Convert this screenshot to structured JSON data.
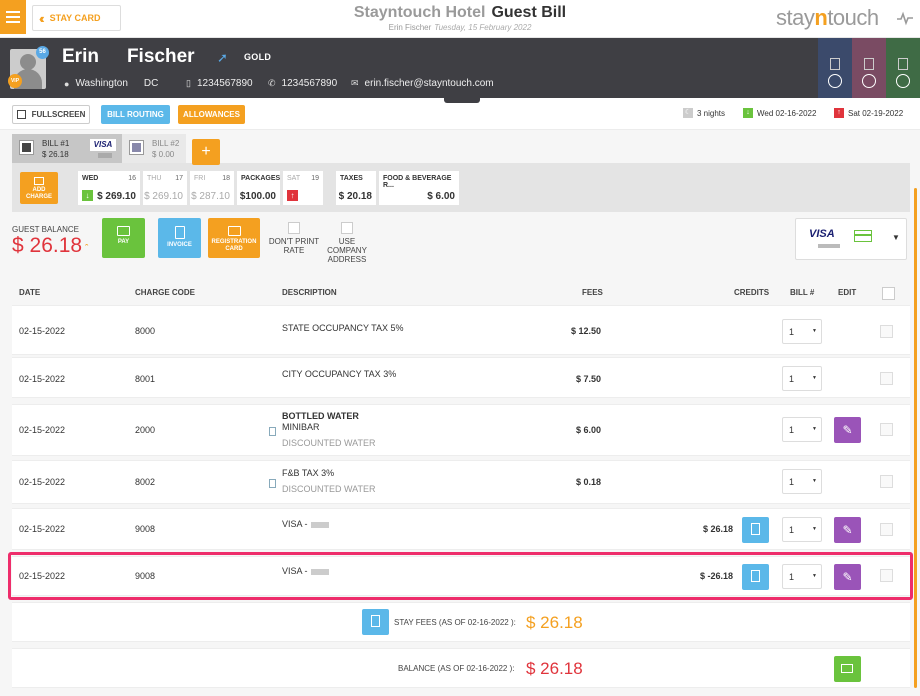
{
  "topbar": {
    "stay_card_label": "STAY CARD",
    "hotel_name": "Stayntouch Hotel",
    "page_title": "Guest Bill",
    "guest_name": "Erin Fischer",
    "date": "Tuesday, 15 February 2022",
    "logo_left": "stay",
    "logo_mid": "n",
    "logo_right": "touch"
  },
  "guest": {
    "first_name": "Erin",
    "last_name": "Fischer",
    "level": "GOLD",
    "vip": "VIP",
    "badge_count": "56",
    "city": "Washington",
    "state": "DC",
    "phone1": "1234567890",
    "phone2": "1234567890",
    "email": "erin.fischer@stayntouch.com"
  },
  "colors": {
    "accent": "#f4a020",
    "header_bg": "#3f3f44",
    "balance_red": "#e0343c",
    "purple": "#9a54b8",
    "blue": "#5bb8e9",
    "green": "#6ac33d",
    "highlight": "#ee2d6b",
    "side_tab_1": "#3b4a6b",
    "side_tab_2": "#7a4b63",
    "side_tab_3": "#3f6b45"
  },
  "actions": {
    "fullscreen": "FULLSCREEN",
    "bill_routing": "BILL ROUTING",
    "allowances": "ALLOWANCES"
  },
  "stay": {
    "nights": "3 nights",
    "arrival": "Wed 02-16-2022",
    "departure": "Sat 02-19-2022"
  },
  "bills": [
    {
      "label": "BILL #1",
      "amount": "$ 26.18",
      "card": "VISA"
    },
    {
      "label": "BILL #2",
      "amount": "$ 0.00"
    }
  ],
  "add_bill": "+",
  "add_charge": "ADD CHARGE",
  "days": [
    {
      "day": "WED",
      "num": "16",
      "value": "$ 269.10"
    },
    {
      "day": "THU",
      "num": "17",
      "value": "$ 269.10"
    },
    {
      "day": "FRI",
      "num": "18",
      "value": "$ 287.10"
    },
    {
      "day": "PACKAGES",
      "num": "",
      "value": "$100.00"
    },
    {
      "day": "SAT",
      "num": "19",
      "value": ""
    },
    {
      "day": "TAXES",
      "num": "",
      "value": "$ 20.18"
    },
    {
      "day": "FOOD & BEVERAGE R...",
      "num": "",
      "value": "$ 6.00"
    }
  ],
  "summary": {
    "guest_balance_label": "GUEST BALANCE",
    "guest_balance": "$ 26.18",
    "pay": "PAY",
    "invoice": "INVOICE",
    "registration_card": "REGISTRATION CARD",
    "dont_print_rate": "DON'T PRINT RATE",
    "use_company_address": "USE COMPANY ADDRESS",
    "card_brand": "VISA"
  },
  "table": {
    "headers": {
      "date": "DATE",
      "charge_code": "CHARGE CODE",
      "description": "DESCRIPTION",
      "fees": "FEES",
      "credits": "CREDITS",
      "bill": "BILL #",
      "edit": "EDIT"
    },
    "rows": [
      {
        "date": "02-15-2022",
        "code": "8000",
        "desc": "STATE OCCUPANCY TAX 5%",
        "sub1": "",
        "sub2": "",
        "fee": "$ 12.50",
        "credit": "",
        "bill": "1"
      },
      {
        "date": "02-15-2022",
        "code": "8001",
        "desc": "CITY OCCUPANCY TAX 3%",
        "sub1": "",
        "sub2": "",
        "fee": "$ 7.50",
        "credit": "",
        "bill": "1"
      },
      {
        "date": "02-15-2022",
        "code": "2000",
        "desc": "BOTTLED WATER",
        "sub1": "MINIBAR",
        "sub2": "DISCOUNTED WATER",
        "fee": "$ 6.00",
        "credit": "",
        "bill": "1"
      },
      {
        "date": "02-15-2022",
        "code": "8002",
        "desc": "F&B TAX 3%",
        "sub1": "",
        "sub2": "DISCOUNTED WATER",
        "fee": "$ 0.18",
        "credit": "",
        "bill": "1"
      },
      {
        "date": "02-15-2022",
        "code": "9008",
        "desc": "VISA -",
        "sub1": "",
        "sub2": "",
        "fee": "",
        "credit": "$ 26.18",
        "bill": "1"
      },
      {
        "date": "02-15-2022",
        "code": "9008",
        "desc": "VISA -",
        "sub1": "",
        "sub2": "",
        "fee": "",
        "credit": "$ -26.18",
        "bill": "1"
      }
    ]
  },
  "totals": {
    "stay_fees_label": "STAY FEES (AS OF 02-16-2022 ):",
    "stay_fees": "$ 26.18",
    "balance_label": "BALANCE (AS OF 02-16-2022 ):",
    "balance": "$ 26.18"
  }
}
